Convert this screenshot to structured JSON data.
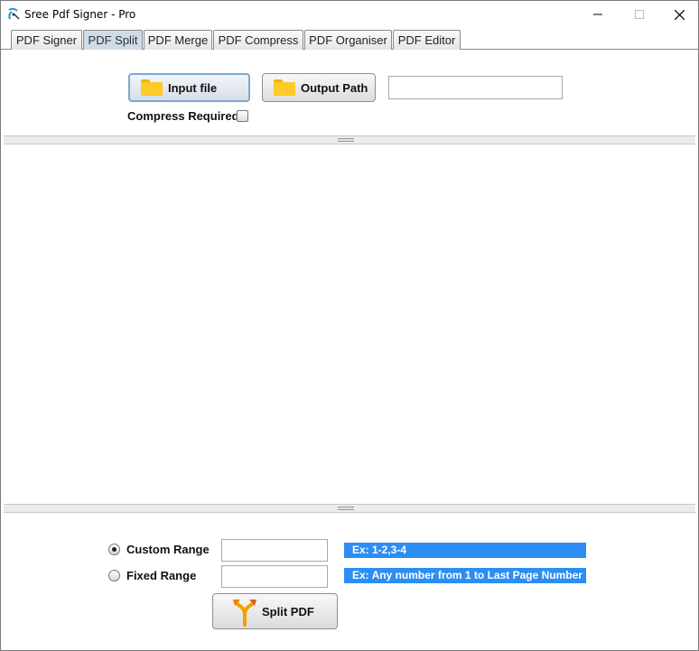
{
  "window": {
    "title": "Sree Pdf Signer - Pro",
    "minimize": "—",
    "maximize": "☐",
    "close": "✕"
  },
  "tabs": [
    {
      "label": "PDF Signer",
      "active": false
    },
    {
      "label": "PDF Split",
      "active": true
    },
    {
      "label": "PDF Merge",
      "active": false
    },
    {
      "label": "PDF Compress",
      "active": false
    },
    {
      "label": "PDF Organiser",
      "active": false
    },
    {
      "label": "PDF Editor",
      "active": false
    }
  ],
  "top_panel": {
    "input_file_label": "Input file",
    "output_path_label": "Output Path",
    "output_path_value": "",
    "compress_label": "Compress Required",
    "compress_checked": false
  },
  "bottom_panel": {
    "custom_range_label": "Custom Range",
    "custom_range_checked": true,
    "custom_range_value": "",
    "custom_range_hint": "Ex: 1-2,3-4",
    "fixed_range_label": "Fixed Range",
    "fixed_range_checked": false,
    "fixed_range_value": "",
    "fixed_range_hint": "Ex: Any number from 1 to Last Page Number",
    "split_button_label": "Split PDF"
  },
  "icons": {
    "app": "app-logo-icon",
    "folder": "folder-icon",
    "split": "split-arrows-icon"
  },
  "colors": {
    "hint_bg": "#2c8ef2",
    "active_tab": "#cfdbe8",
    "folder": "#ffc928"
  }
}
